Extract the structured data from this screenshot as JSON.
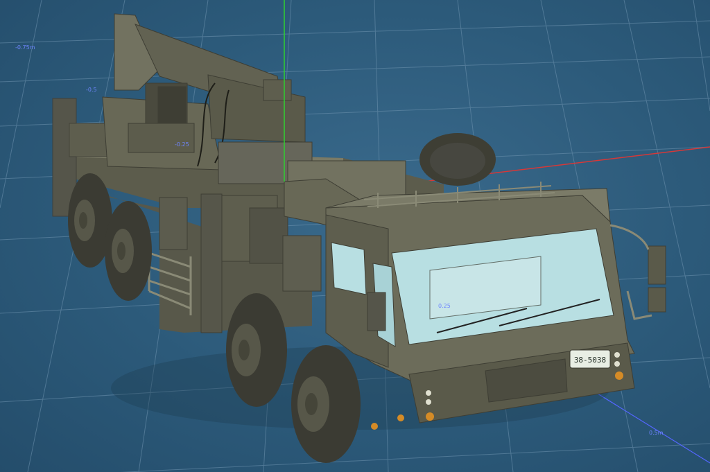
{
  "viewport": {
    "ruler_labels": [
      "-0.75m",
      "-0.5",
      "-0.25",
      "0.25",
      "0.5m"
    ]
  },
  "model": {
    "license_plate": "38-5038"
  },
  "colors": {
    "background": "#2c5a7a",
    "grid_line": "#6f94b0",
    "axis_y": "#2fd12f",
    "axis_x": "#d63838",
    "axis_z": "#5466ff",
    "body": "#6b6b5a",
    "body_dark": "#4c4c40",
    "body_light": "#80806c",
    "glass": "#b8dfe2",
    "tire": "#3f3f35"
  }
}
